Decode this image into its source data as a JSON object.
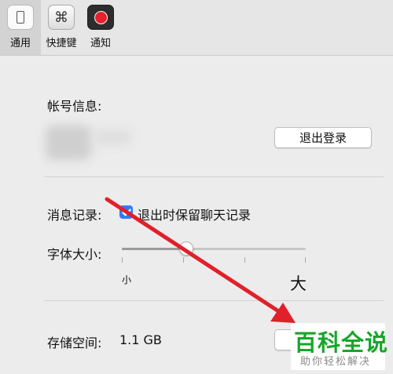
{
  "toolbar": {
    "tabs": [
      {
        "label": "通用",
        "icon": "general-icon",
        "selected": true
      },
      {
        "label": "快捷键",
        "icon": "command-key-icon",
        "glyph": "⌘"
      },
      {
        "label": "通知",
        "icon": "record-icon"
      }
    ]
  },
  "account": {
    "label": "帐号信息:",
    "logout_label": "退出登录"
  },
  "history": {
    "label": "消息记录:",
    "checkbox_label": "退出时保留聊天记录",
    "checked": true
  },
  "font_size": {
    "label": "字体大小:",
    "small_label": "小",
    "large_label": "大",
    "value_fraction": 0.35
  },
  "storage": {
    "label": "存储空间:",
    "value": "1.1 GB"
  },
  "watermark": {
    "title": "百科全说",
    "subtitle": "助你轻松解决"
  },
  "colors": {
    "accent": "#2f7cf6",
    "record": "#e6212b",
    "annotation_arrow": "#e0202a",
    "watermark_green": "#17a52a"
  }
}
